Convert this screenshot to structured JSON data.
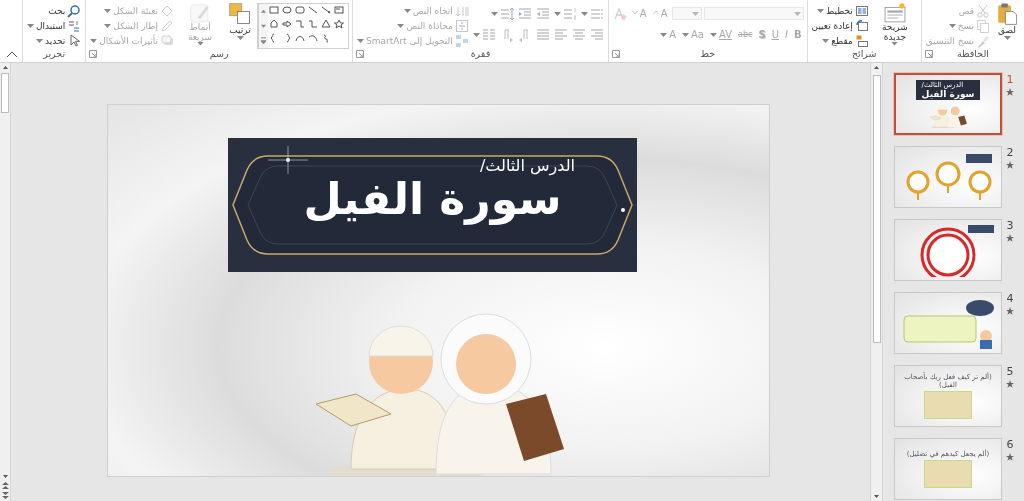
{
  "ribbon": {
    "groups": [
      {
        "label": "الحافظة",
        "launcher": true,
        "columns": [
          {
            "kind": "large",
            "label": "لصق",
            "disabled": false,
            "dropdown": true
          },
          {
            "kind": "stack",
            "rows": [
              [
                {
                  "kind": "button",
                  "label": "قص",
                  "disabled": true,
                  "dropdown": false
                }
              ],
              [
                {
                  "kind": "button",
                  "label": "نسخ",
                  "disabled": true,
                  "dropdown": true
                }
              ],
              [
                {
                  "kind": "button",
                  "label": "نسخ التنسيق",
                  "disabled": true,
                  "dropdown": false
                }
              ]
            ]
          }
        ]
      },
      {
        "label": "شرائح",
        "launcher": false,
        "columns": [
          {
            "kind": "large",
            "label": "شريحة جديدة",
            "disabled": false,
            "dropdown": true
          },
          {
            "kind": "stack",
            "rows": [
              [
                {
                  "kind": "button",
                  "label": "تخطيط",
                  "disabled": false,
                  "dropdown": true
                }
              ],
              [
                {
                  "kind": "button",
                  "label": "إعادة تعيين",
                  "disabled": false,
                  "dropdown": false
                }
              ],
              [
                {
                  "kind": "button",
                  "label": "مقطع",
                  "disabled": false,
                  "dropdown": true
                }
              ]
            ]
          }
        ]
      },
      {
        "label": "خط",
        "launcher": true,
        "columns": [
          {
            "kind": "stack",
            "rows": [
              [
                {
                  "kind": "font_field",
                  "disabled": true
                },
                {
                  "kind": "size_field",
                  "disabled": true
                },
                {
                  "kind": "glyph",
                  "label": "A",
                  "disabled": true,
                  "dropdown": false
                },
                {
                  "kind": "glyph",
                  "label": "A",
                  "disabled": true,
                  "dropdown": false
                },
                {
                  "kind": "button",
                  "disabled": true,
                  "dropdown": false
                }
              ],
              [
                {
                  "kind": "glyph",
                  "label": "B",
                  "disabled": true,
                  "dropdown": false
                },
                {
                  "kind": "glyph",
                  "label": "I",
                  "disabled": true,
                  "dropdown": false
                },
                {
                  "kind": "glyph",
                  "label": "U",
                  "disabled": true,
                  "dropdown": false
                },
                {
                  "kind": "glyph",
                  "label": "S",
                  "disabled": true,
                  "dropdown": false
                },
                {
                  "kind": "glyph",
                  "label": "abc",
                  "disabled": true,
                  "dropdown": false
                },
                {
                  "kind": "glyph",
                  "label": "AV",
                  "disabled": true,
                  "dropdown": true
                },
                {
                  "kind": "glyph",
                  "label": "Aa",
                  "disabled": true,
                  "dropdown": true
                },
                {
                  "kind": "glyph",
                  "label": "A",
                  "disabled": true,
                  "dropdown": true
                }
              ]
            ]
          }
        ]
      },
      {
        "label": "فقرة",
        "launcher": true,
        "columns": [
          {
            "kind": "stack",
            "rows": [
              [
                {
                  "kind": "button",
                  "disabled": true,
                  "dropdown": true
                },
                {
                  "kind": "button",
                  "disabled": true,
                  "dropdown": true
                },
                {
                  "kind": "button",
                  "disabled": true,
                  "dropdown": false
                },
                {
                  "kind": "button",
                  "disabled": true,
                  "dropdown": false
                },
                {
                  "kind": "button",
                  "disabled": true,
                  "dropdown": true
                }
              ],
              [
                {
                  "kind": "button",
                  "disabled": true,
                  "dropdown": false
                },
                {
                  "kind": "button",
                  "disabled": true,
                  "dropdown": false
                },
                {
                  "kind": "button",
                  "disabled": true,
                  "dropdown": false
                },
                {
                  "kind": "button",
                  "disabled": true,
                  "dropdown": false
                },
                {
                  "kind": "button",
                  "disabled": true,
                  "dropdown": false
                },
                {
                  "kind": "button",
                  "disabled": true,
                  "dropdown": false
                },
                {
                  "kind": "button",
                  "disabled": true,
                  "dropdown": true
                }
              ]
            ]
          },
          {
            "kind": "stack",
            "rows": [
              [
                {
                  "kind": "button",
                  "label": "اتجاه النص",
                  "disabled": true,
                  "dropdown": true
                }
              ],
              [
                {
                  "kind": "button",
                  "label": "محاذاة النص",
                  "disabled": true,
                  "dropdown": true
                }
              ],
              [
                {
                  "kind": "button",
                  "label": "التحويل إلى SmartArt",
                  "disabled": true,
                  "dropdown": true
                }
              ]
            ]
          }
        ]
      },
      {
        "label": "رسم",
        "launcher": true,
        "columns": [
          {
            "kind": "gallery"
          },
          {
            "kind": "large",
            "label": "ترتيب",
            "disabled": false,
            "dropdown": true
          },
          {
            "kind": "large",
            "label": "أنماط سريعة",
            "disabled": true,
            "dropdown": true
          },
          {
            "kind": "stack",
            "rows": [
              [
                {
                  "kind": "button",
                  "label": "تعبئة الشكل",
                  "disabled": true,
                  "dropdown": true
                }
              ],
              [
                {
                  "kind": "button",
                  "label": "إطار الشكل",
                  "disabled": true,
                  "dropdown": true
                }
              ],
              [
                {
                  "kind": "button",
                  "label": "تأثيرات الأشكال",
                  "disabled": true,
                  "dropdown": true
                }
              ]
            ]
          }
        ]
      },
      {
        "label": "تحرير",
        "launcher": false,
        "columns": [
          {
            "kind": "stack",
            "rows": [
              [
                {
                  "kind": "button",
                  "label": "بحث",
                  "disabled": false,
                  "dropdown": false
                }
              ],
              [
                {
                  "kind": "button",
                  "label": "استبدال",
                  "disabled": false,
                  "dropdown": true
                }
              ],
              [
                {
                  "kind": "button",
                  "label": "تحديد",
                  "disabled": false,
                  "dropdown": true
                }
              ]
            ]
          }
        ]
      }
    ]
  },
  "slide": {
    "subtitle": "الدرس الثالث/",
    "title": "سورة الفيل"
  },
  "thumbnails": [
    {
      "number": "1",
      "selected": true,
      "kind": "title",
      "texts": [
        "الدرس الثالث/",
        "سورة الفيل"
      ]
    },
    {
      "number": "2",
      "selected": false,
      "kind": "pins"
    },
    {
      "number": "3",
      "selected": false,
      "kind": "rings"
    },
    {
      "number": "4",
      "selected": false,
      "kind": "scroll"
    },
    {
      "number": "5",
      "selected": false,
      "kind": "picture",
      "texts": [
        "(ألم تر كيف فعل ربك بأصحاب الفيل)"
      ]
    },
    {
      "number": "6",
      "selected": false,
      "kind": "picture",
      "texts": [
        "(ألم يجعل كيدهم في تضليل)"
      ]
    }
  ]
}
